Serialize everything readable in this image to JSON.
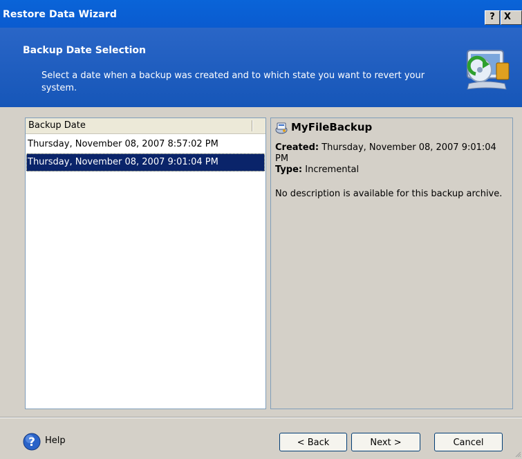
{
  "window": {
    "title": "Restore Data Wizard",
    "help_glyph": "?",
    "close_glyph": "X"
  },
  "header": {
    "title": "Backup Date Selection",
    "description": "Select a date when a backup was created and to which state you want to revert your system.",
    "icon": "restore-computer-icon"
  },
  "list": {
    "column_header": "Backup Date",
    "rows": [
      {
        "label": "Thursday, November 08, 2007 8:57:02 PM",
        "selected": false
      },
      {
        "label": "Thursday, November 08, 2007 9:01:04 PM",
        "selected": true
      }
    ]
  },
  "details": {
    "name": "MyFileBackup",
    "icon": "backup-archive-icon",
    "created_label": "Created:",
    "created_value": "Thursday, November 08, 2007 9:01:04 PM",
    "type_label": "Type:",
    "type_value": "Incremental",
    "description": "No description is available for this backup archive."
  },
  "footer": {
    "help_label": "Help",
    "back_label": "< Back",
    "next_label": "Next >",
    "cancel_label": "Cancel"
  },
  "colors": {
    "title_bar": "#0a5bd0",
    "header_band": "#1a5abf",
    "selection": "#0a246a",
    "dialog_face": "#d4d0c8"
  }
}
